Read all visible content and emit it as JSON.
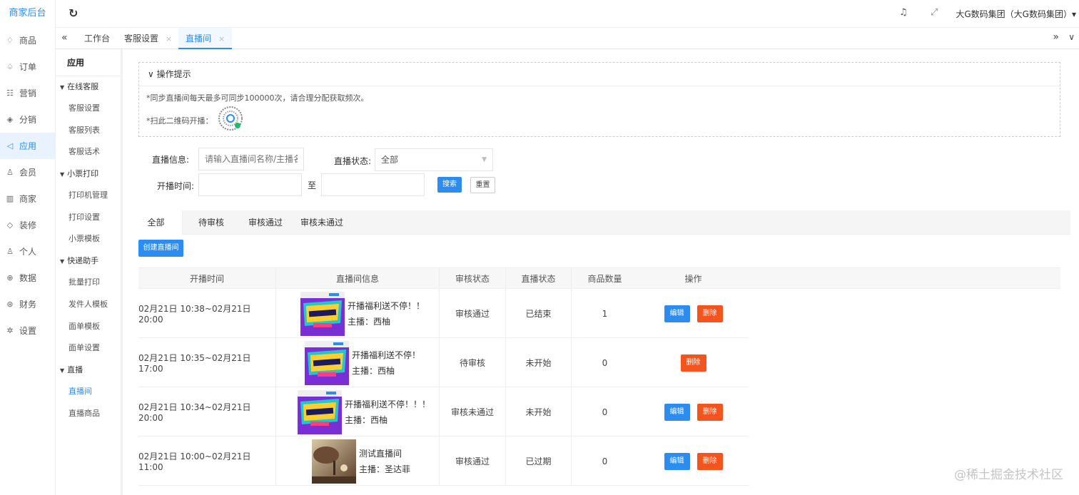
{
  "sidebar": {
    "brand": "商家后台",
    "items": [
      {
        "label": "商品",
        "icon": "diamond-icon",
        "glyph": "♢"
      },
      {
        "label": "订单",
        "icon": "bell-icon",
        "glyph": "♤"
      },
      {
        "label": "营销",
        "icon": "marketing-icon",
        "glyph": "☷"
      },
      {
        "label": "分销",
        "icon": "layers-icon",
        "glyph": "◈"
      },
      {
        "label": "应用",
        "icon": "send-icon",
        "glyph": "◁"
      },
      {
        "label": "会员",
        "icon": "user-icon",
        "glyph": "♙"
      },
      {
        "label": "商家",
        "icon": "shop-icon",
        "glyph": "▥"
      },
      {
        "label": "装修",
        "icon": "tag-icon",
        "glyph": "◇"
      },
      {
        "label": "个人",
        "icon": "person-icon",
        "glyph": "♙"
      },
      {
        "label": "数据",
        "icon": "globe-icon",
        "glyph": "⊕"
      },
      {
        "label": "财务",
        "icon": "yen-icon",
        "glyph": "⊛"
      },
      {
        "label": "设置",
        "icon": "gear-icon",
        "glyph": "✲"
      }
    ],
    "active_index": 4
  },
  "header": {
    "refresh_glyph": "↻",
    "bell_glyph": "♫",
    "fullscreen_glyph": "⤢",
    "user": "大G数码集团（大G数码集团）▾"
  },
  "tabs": {
    "prev_glyph": "«",
    "next_glyph": "»",
    "drop_glyph": "∨",
    "close_glyph": "×",
    "items": [
      {
        "label": "工作台"
      },
      {
        "label": "客服设置"
      },
      {
        "label": "直播间"
      }
    ]
  },
  "submenu": {
    "title": "应用",
    "groups": [
      {
        "label": "在线客服",
        "items": [
          "客服设置",
          "客服列表",
          "客服话术"
        ]
      },
      {
        "label": "小票打印",
        "items": [
          "打印机管理",
          "打印设置",
          "小票模板"
        ]
      },
      {
        "label": "快递助手",
        "items": [
          "批量打印",
          "发件人模板",
          "面单模板",
          "面单设置"
        ]
      },
      {
        "label": "直播",
        "items": [
          "直播间",
          "直播商品"
        ]
      }
    ]
  },
  "tips": {
    "title": "操作提示",
    "line1": "*同步直播间每天最多可同步100000次，请合理分配获取频次。",
    "line2": "*扫此二维码开播："
  },
  "filters": {
    "info_label": "直播信息:",
    "info_placeholder": "请输入直播间名称/主播名称",
    "status_label": "直播状态:",
    "status_value": "全部",
    "time_label": "开播时间:",
    "to_label": "至",
    "search_btn": "搜索",
    "reset_btn": "重置"
  },
  "status_tabs": [
    "全部",
    "待审核",
    "审核通过",
    "审核未通过"
  ],
  "create_btn": "创建直播间",
  "table": {
    "headers": [
      "开播时间",
      "直播间信息",
      "审核状态",
      "直播状态",
      "商品数量",
      "操作"
    ],
    "edit_label": "编辑",
    "delete_label": "删除",
    "rows": [
      {
        "time": "02月21日 10:38~02月21日 20:00",
        "name": "开播福利送不停！！",
        "anchor": "主播：西柚",
        "audit": "审核通过",
        "live": "已结束",
        "count": "1",
        "editable": true
      },
      {
        "time": "02月21日 10:35~02月21日 17:00",
        "name": "开播福利送不停！",
        "anchor": "主播：西柚",
        "audit": "待审核",
        "live": "未开始",
        "count": "0",
        "editable": false
      },
      {
        "time": "02月21日 10:34~02月21日 20:00",
        "name": "开播福利送不停！！！",
        "anchor": "主播：西柚",
        "audit": "审核未通过",
        "live": "未开始",
        "count": "0",
        "editable": true
      },
      {
        "time": "02月21日 10:00~02月21日 11:00",
        "name": "测试直播间",
        "anchor": "主播：圣达菲",
        "audit": "审核通过",
        "live": "已过期",
        "count": "0",
        "editable": true
      }
    ]
  },
  "watermark": "@稀土掘金技术社区",
  "colors": {
    "accent": "#2d8cf0",
    "danger": "#f5541e"
  }
}
